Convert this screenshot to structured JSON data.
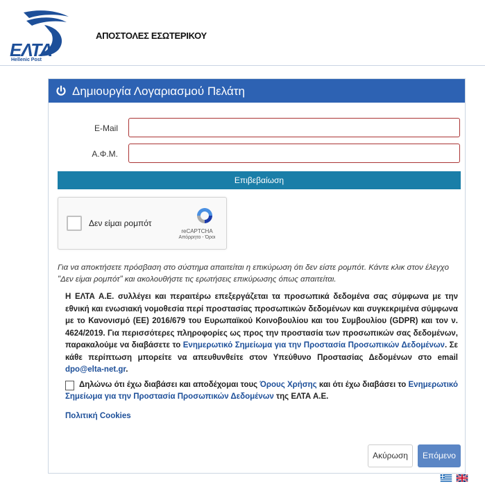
{
  "header": {
    "logo_text": "ΕΛΤΑ",
    "logo_sub": "Hellenic Post",
    "title": "ΑΠΟΣΤΟΛΕΣ ΕΣΩΤΕΡΙΚΟΥ"
  },
  "panel": {
    "title": "Δημιουργία Λογαριασμού Πελάτη",
    "head_color": "#2d62b3",
    "email_label": "E-Mail",
    "email_value": "",
    "afm_label": "Α.Φ.Μ.",
    "afm_value": "",
    "verify_label": "Επιβεβαίωση"
  },
  "captcha": {
    "label": "Δεν είμαι ρομπότ",
    "brand": "reCAPTCHA",
    "terms": "Απόρρητο - Όροι"
  },
  "info_italic": "Για να αποκτήσετε πρόσβαση στο σύστημα απαιτείται η επικύρωση ότι δεν είστε ρομπότ. Κάντε κλικ στον έλεγχο \"Δεν είμαι ρομπότ\" και ακολουθήστε τις ερωτήσεις επικύρωσης όπως απαιτείται.",
  "privacy": {
    "text_1": "Η ΕΛΤΑ Α.Ε. συλλέγει και περαιτέρω επεξεργάζεται τα προσωπικά δεδομένα σας σύμφωνα με την εθνική και ενωσιακή νομοθεσία περί προστασίας προσωπικών δεδομένων και συγκεκριμένα σύμφωνα με το Κανονισμό (ΕΕ) 2016/679 του Ευρωπαϊκού Κοινοβουλίου και του Συμβουλίου (GDPR) και τον ν. 4624/2019. Για περισσότερες πληροφορίες ως προς την προστασία των προσωπικών σας δεδομένων, παρακαλούμε να διαβάσετε το ",
    "link_notice": "Ενημερωτικό Σημείωμα για την Προστασία Προσωπικών Δεδομένων",
    "text_2": ". Σε κάθε περίπτωση μπορείτε να απευθυνθείτε στον Υπεύθυνο Προστασίας Δεδομένων στο email ",
    "email": "dpo@elta-net.gr",
    "text_3": "."
  },
  "agree": {
    "text_1": "Δηλώνω ότι έχω διαβάσει και αποδέχομαι τους ",
    "link_terms": "Όρους Χρήσης",
    "text_2": " και ότι έχω διαβάσει το ",
    "link_notice": "Ενημερωτικό Σημείωμα για την Προστασία Προσωπικών Δεδομένων",
    "text_3": " της ΕΛΤΑ Α.Ε."
  },
  "cookies_link": "Πολιτική Cookies",
  "buttons": {
    "cancel": "Ακύρωση",
    "next": "Επόμενο"
  }
}
